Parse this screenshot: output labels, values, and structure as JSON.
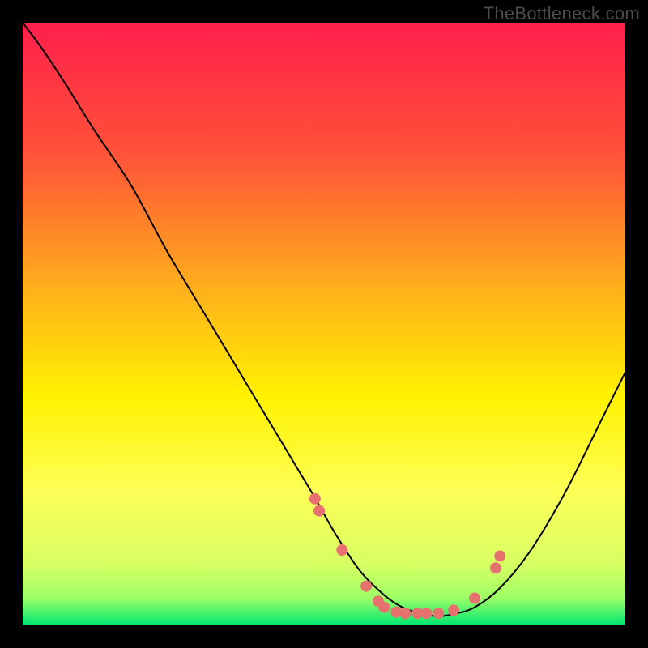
{
  "watermark": "TheBottleneck.com",
  "chart_data": {
    "type": "line",
    "title": "",
    "xlabel": "",
    "ylabel": "",
    "xlim": [
      0,
      100
    ],
    "ylim": [
      0,
      100
    ],
    "grid": false,
    "legend": false,
    "background_gradient": {
      "stops": [
        {
          "offset": 0.0,
          "color": "#ff1f4b"
        },
        {
          "offset": 0.22,
          "color": "#ff5338"
        },
        {
          "offset": 0.45,
          "color": "#ffb31a"
        },
        {
          "offset": 0.62,
          "color": "#fff200"
        },
        {
          "offset": 0.78,
          "color": "#fdff58"
        },
        {
          "offset": 0.9,
          "color": "#d6ff63"
        },
        {
          "offset": 0.955,
          "color": "#9cff66"
        },
        {
          "offset": 1.0,
          "color": "#00e673"
        }
      ]
    },
    "series": [
      {
        "name": "curve",
        "color": "#000000",
        "x": [
          0,
          3,
          7,
          12,
          18,
          24,
          30,
          36,
          42,
          48,
          52,
          56,
          60,
          63,
          66,
          69,
          72,
          75,
          79,
          84,
          90,
          96,
          100
        ],
        "y": [
          100,
          96,
          90,
          82,
          73,
          62,
          52,
          42,
          32,
          22,
          15,
          9,
          5,
          3,
          2,
          1.5,
          2,
          3,
          6,
          12,
          22,
          34,
          42
        ]
      }
    ],
    "markers": {
      "name": "dots",
      "color": "#e6716f",
      "radius_px": 7,
      "x": [
        48.5,
        49.2,
        53.0,
        57.0,
        59.0,
        60.0,
        62.0,
        63.5,
        65.5,
        67.0,
        69.0,
        71.5,
        75.0,
        78.5,
        79.2
      ],
      "y": [
        21.0,
        19.0,
        12.5,
        6.5,
        4.0,
        3.0,
        2.2,
        2.0,
        2.0,
        2.0,
        2.0,
        2.5,
        4.5,
        9.5,
        11.5
      ]
    }
  }
}
